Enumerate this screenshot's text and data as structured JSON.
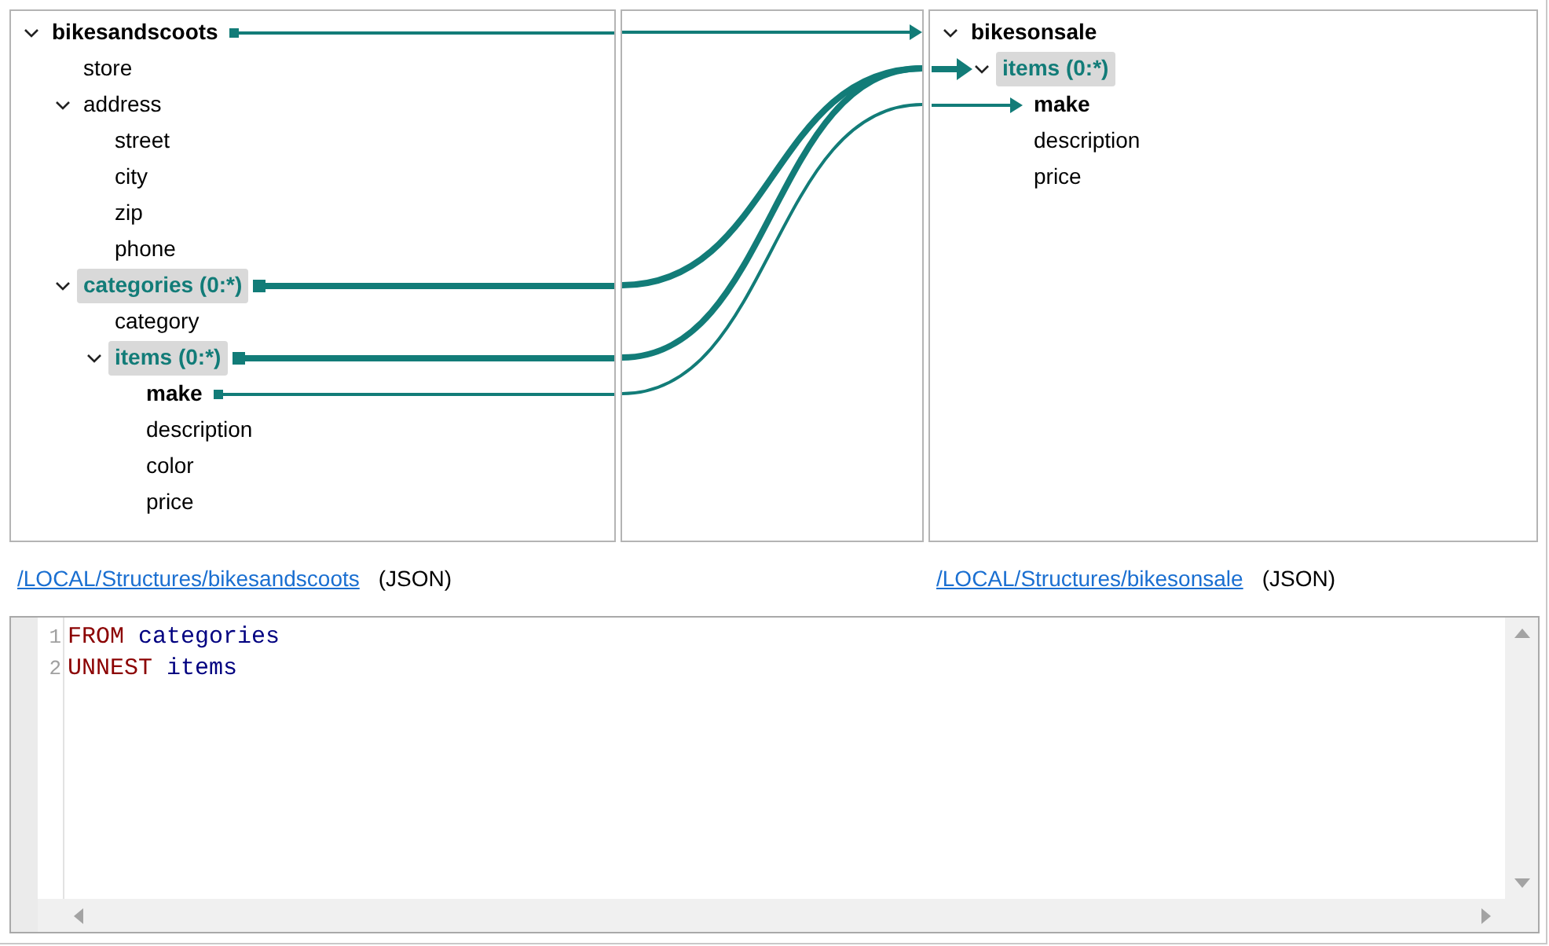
{
  "source": {
    "tree": [
      {
        "label": "bikesandscoots",
        "kind": "root",
        "mapped": true,
        "expanded": true,
        "children": [
          {
            "label": "store",
            "kind": "field",
            "mapped": false
          },
          {
            "label": "address",
            "kind": "object",
            "mapped": false,
            "expanded": true,
            "children": [
              {
                "label": "street",
                "kind": "field",
                "mapped": false
              },
              {
                "label": "city",
                "kind": "field",
                "mapped": false
              },
              {
                "label": "zip",
                "kind": "field",
                "mapped": false
              },
              {
                "label": "phone",
                "kind": "field",
                "mapped": false
              }
            ]
          },
          {
            "label": "categories (0:*)",
            "kind": "collection",
            "mapped": true,
            "expanded": true,
            "children": [
              {
                "label": "category",
                "kind": "field",
                "mapped": false
              },
              {
                "label": "items (0:*)",
                "kind": "collection",
                "mapped": true,
                "expanded": true,
                "children": [
                  {
                    "label": "make",
                    "kind": "field",
                    "mapped": true
                  },
                  {
                    "label": "description",
                    "kind": "field",
                    "mapped": false
                  },
                  {
                    "label": "color",
                    "kind": "field",
                    "mapped": false
                  },
                  {
                    "label": "price",
                    "kind": "field",
                    "mapped": false
                  }
                ]
              }
            ]
          }
        ]
      }
    ],
    "path": "/LOCAL/Structures/bikesandscoots",
    "format": "(JSON)"
  },
  "target": {
    "tree": [
      {
        "label": "bikesonsale",
        "kind": "root",
        "mapped": true,
        "expanded": true,
        "children": [
          {
            "label": "items (0:*)",
            "kind": "collection",
            "mapped": true,
            "expanded": true,
            "children": [
              {
                "label": "make",
                "kind": "field",
                "mapped": true
              },
              {
                "label": "description",
                "kind": "field",
                "mapped": false
              },
              {
                "label": "price",
                "kind": "field",
                "mapped": false
              }
            ]
          }
        ]
      }
    ],
    "path": "/LOCAL/Structures/bikesonsale",
    "format": "(JSON)"
  },
  "editor": {
    "lines": [
      {
        "number": "1",
        "tokens": [
          {
            "text": "FROM",
            "kind": "keyword"
          },
          {
            "text": "categories",
            "kind": "identifier"
          }
        ]
      },
      {
        "number": "2",
        "tokens": [
          {
            "text": "UNNEST",
            "kind": "keyword"
          },
          {
            "text": "items",
            "kind": "identifier"
          }
        ]
      }
    ]
  }
}
